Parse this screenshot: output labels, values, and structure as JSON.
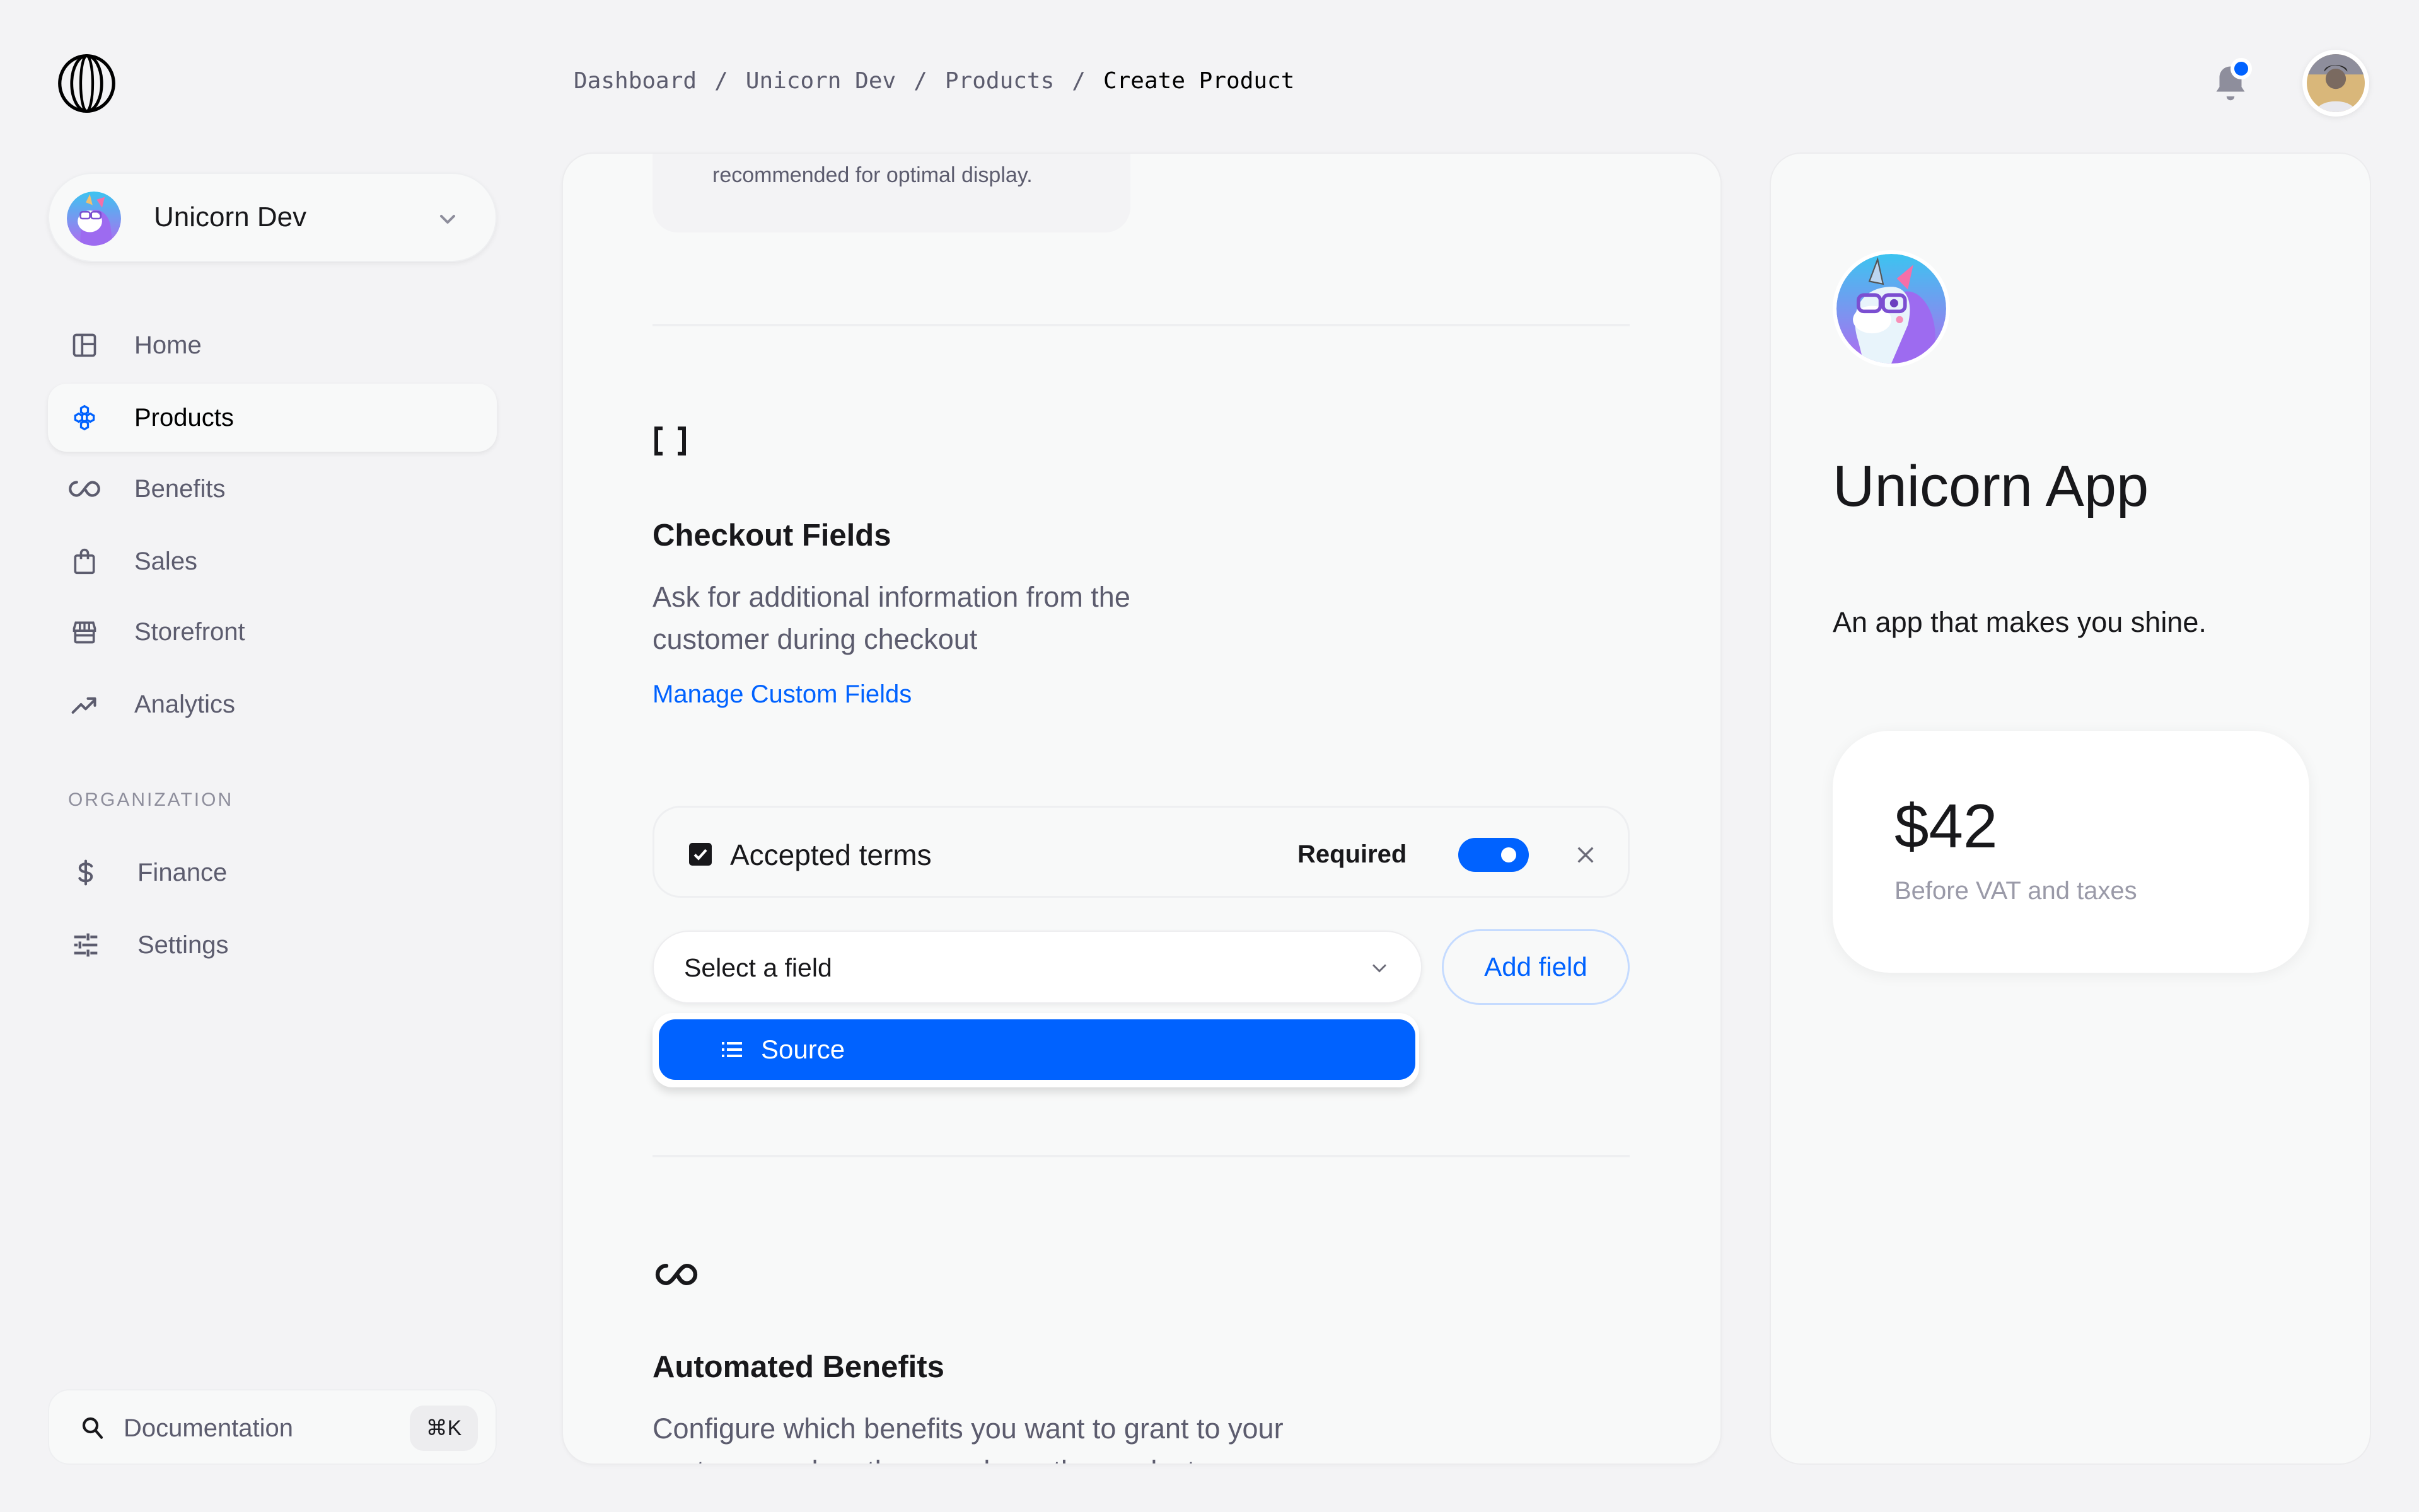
{
  "app": {
    "logo_icon": "polar-logo-icon"
  },
  "workspace": {
    "name": "Unicorn Dev",
    "avatar_icon": "unicorn-avatar"
  },
  "sidebar": {
    "items": [
      {
        "label": "Home",
        "icon": "layout-icon",
        "active": false
      },
      {
        "label": "Products",
        "icon": "hexagons-icon",
        "active": true
      },
      {
        "label": "Benefits",
        "icon": "infinity-icon",
        "active": false
      },
      {
        "label": "Sales",
        "icon": "shopping-bag-icon",
        "active": false
      },
      {
        "label": "Storefront",
        "icon": "storefront-icon",
        "active": false
      },
      {
        "label": "Analytics",
        "icon": "trending-up-icon",
        "active": false
      }
    ],
    "org_section_label": "ORGANIZATION",
    "org_items": [
      {
        "label": "Finance",
        "icon": "dollar-icon"
      },
      {
        "label": "Settings",
        "icon": "sliders-icon"
      }
    ],
    "docs": {
      "label": "Documentation",
      "shortcut": "⌘K"
    }
  },
  "breadcrumb": {
    "items": [
      "Dashboard",
      "Unicorn Dev",
      "Products",
      "Create Product"
    ],
    "separator": "/"
  },
  "header": {
    "notifications_unread": true,
    "accent": "#0062ff"
  },
  "main": {
    "media_hint": "recommended for optimal display.",
    "checkout_fields": {
      "icon": "brackets-icon",
      "title": "Checkout Fields",
      "description": "Ask for additional information from the customer during checkout",
      "manage_link": "Manage Custom Fields",
      "fields": [
        {
          "name": "Accepted terms",
          "checked": true,
          "required_label": "Required",
          "required": true
        }
      ],
      "select": {
        "placeholder": "Select a field",
        "options": [
          {
            "label": "Source",
            "icon": "list-icon",
            "highlighted": true
          }
        ]
      },
      "add_button": "Add field"
    },
    "benefits": {
      "icon": "infinity-icon",
      "title": "Automated Benefits",
      "description": "Configure which benefits you want to grant to your customers when they purchase the product"
    }
  },
  "preview": {
    "app_name": "Unicorn App",
    "tagline": "An app that makes you shine.",
    "price": "$42",
    "price_note": "Before VAT and taxes"
  }
}
